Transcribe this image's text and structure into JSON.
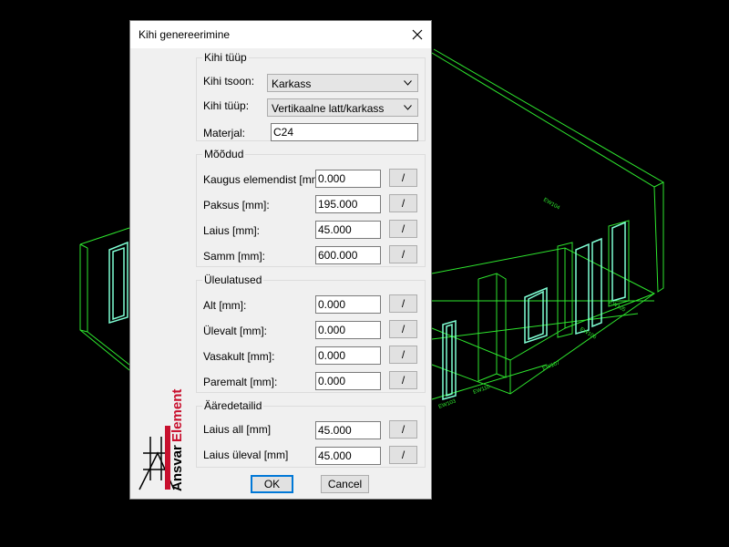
{
  "dialog": {
    "title": "Kihi genereerimine",
    "close_label": "×"
  },
  "brand": {
    "text_black": "Ansvar",
    "text_red": "Element"
  },
  "layer_type": {
    "legend": "Kihi tüüp",
    "zone_label": "Kihi tsoon:",
    "zone_value": "Karkass",
    "type_label": "Kihi tüüp:",
    "type_value": "Vertikaalne latt/karkass",
    "material_label": "Materjal:",
    "material_value": "C24"
  },
  "dimensions": {
    "legend": "Mõõdud",
    "rows": [
      {
        "label": "Kaugus elemendist [mm]:",
        "value": "0.000",
        "pick": "/"
      },
      {
        "label": "Paksus [mm]:",
        "value": "195.000",
        "pick": "/"
      },
      {
        "label": "Laius [mm]:",
        "value": "45.000",
        "pick": "/"
      },
      {
        "label": "Samm [mm]:",
        "value": "600.000",
        "pick": "/"
      }
    ]
  },
  "overhangs": {
    "legend": "Üleulatused",
    "rows": [
      {
        "label": "Alt [mm]:",
        "value": "0.000",
        "pick": "/"
      },
      {
        "label": "Ülevalt [mm]:",
        "value": "0.000",
        "pick": "/"
      },
      {
        "label": "Vasakult [mm]:",
        "value": "0.000",
        "pick": "/"
      },
      {
        "label": "Paremalt [mm]:",
        "value": "0.000",
        "pick": "/"
      }
    ]
  },
  "edge_details": {
    "legend": "Ääredetailid",
    "rows": [
      {
        "label": "Laius all [mm]",
        "value": "45.000",
        "pick": "/"
      },
      {
        "label": "Laius üleval [mm]",
        "value": "45.000",
        "pick": "/"
      }
    ]
  },
  "buttons": {
    "ok": "OK",
    "cancel": "Cancel"
  },
  "colors": {
    "cad_lines": "#2ee62e",
    "cad_openings": "#7fffd4",
    "brand_red": "#c8102e"
  },
  "icons": [
    "close-icon",
    "dropdown-arrow-icon",
    "ansvar-element-logo"
  ]
}
